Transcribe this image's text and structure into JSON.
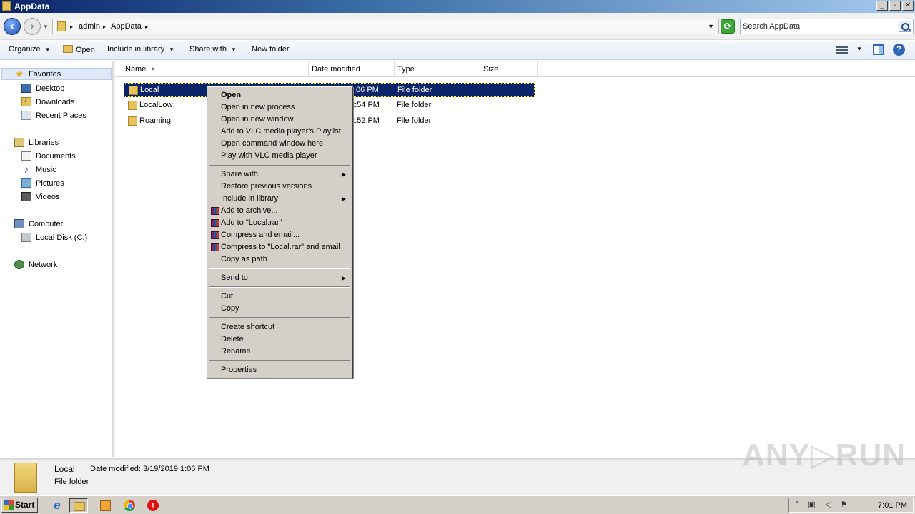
{
  "window": {
    "title": "AppData",
    "min_glyph": "_",
    "max_glyph": "▫",
    "close_glyph": "✕"
  },
  "address": {
    "crumbs": [
      "admin",
      "AppData"
    ],
    "search_placeholder": "Search AppData"
  },
  "toolbar": {
    "organize": "Organize",
    "open": "Open",
    "include_in_library": "Include in library",
    "share_with": "Share with",
    "new_folder": "New folder"
  },
  "nav": {
    "favorites": "Favorites",
    "desktop": "Desktop",
    "downloads": "Downloads",
    "recent_places": "Recent Places",
    "libraries": "Libraries",
    "documents": "Documents",
    "music": "Music",
    "pictures": "Pictures",
    "videos": "Videos",
    "computer": "Computer",
    "local_disk": "Local Disk (C:)",
    "network": "Network"
  },
  "columns": {
    "name": "Name",
    "date_modified": "Date modified",
    "type": "Type",
    "size": "Size"
  },
  "rows": [
    {
      "name": "Local",
      "date": ":06 PM",
      "type": "File folder",
      "selected": true
    },
    {
      "name": "LocalLow",
      "date": "2:54 PM",
      "type": "File folder",
      "selected": false
    },
    {
      "name": "Roaming",
      "date": "2:52 PM",
      "type": "File folder",
      "selected": false
    }
  ],
  "context_menu": {
    "open": "Open",
    "open_new_process": "Open in new process",
    "open_new_window": "Open in new window",
    "add_vlc_playlist": "Add to VLC media player's Playlist",
    "open_cmd_here": "Open command window here",
    "play_vlc": "Play with VLC media player",
    "share_with": "Share with",
    "restore_prev": "Restore previous versions",
    "include_library": "Include in library",
    "add_archive": "Add to archive...",
    "add_local_rar": "Add to \"Local.rar\"",
    "compress_email": "Compress and email...",
    "compress_local_rar_email": "Compress to \"Local.rar\" and email",
    "copy_as_path": "Copy as path",
    "send_to": "Send to",
    "cut": "Cut",
    "copy": "Copy",
    "create_shortcut": "Create shortcut",
    "delete": "Delete",
    "rename": "Rename",
    "properties": "Properties"
  },
  "details": {
    "name": "Local",
    "date_label": "Date modified:",
    "date_value": "3/19/2019 1:06 PM",
    "type": "File folder"
  },
  "watermark": "ANY▷RUN",
  "taskbar": {
    "start": "Start",
    "clock": "7:01 PM"
  }
}
